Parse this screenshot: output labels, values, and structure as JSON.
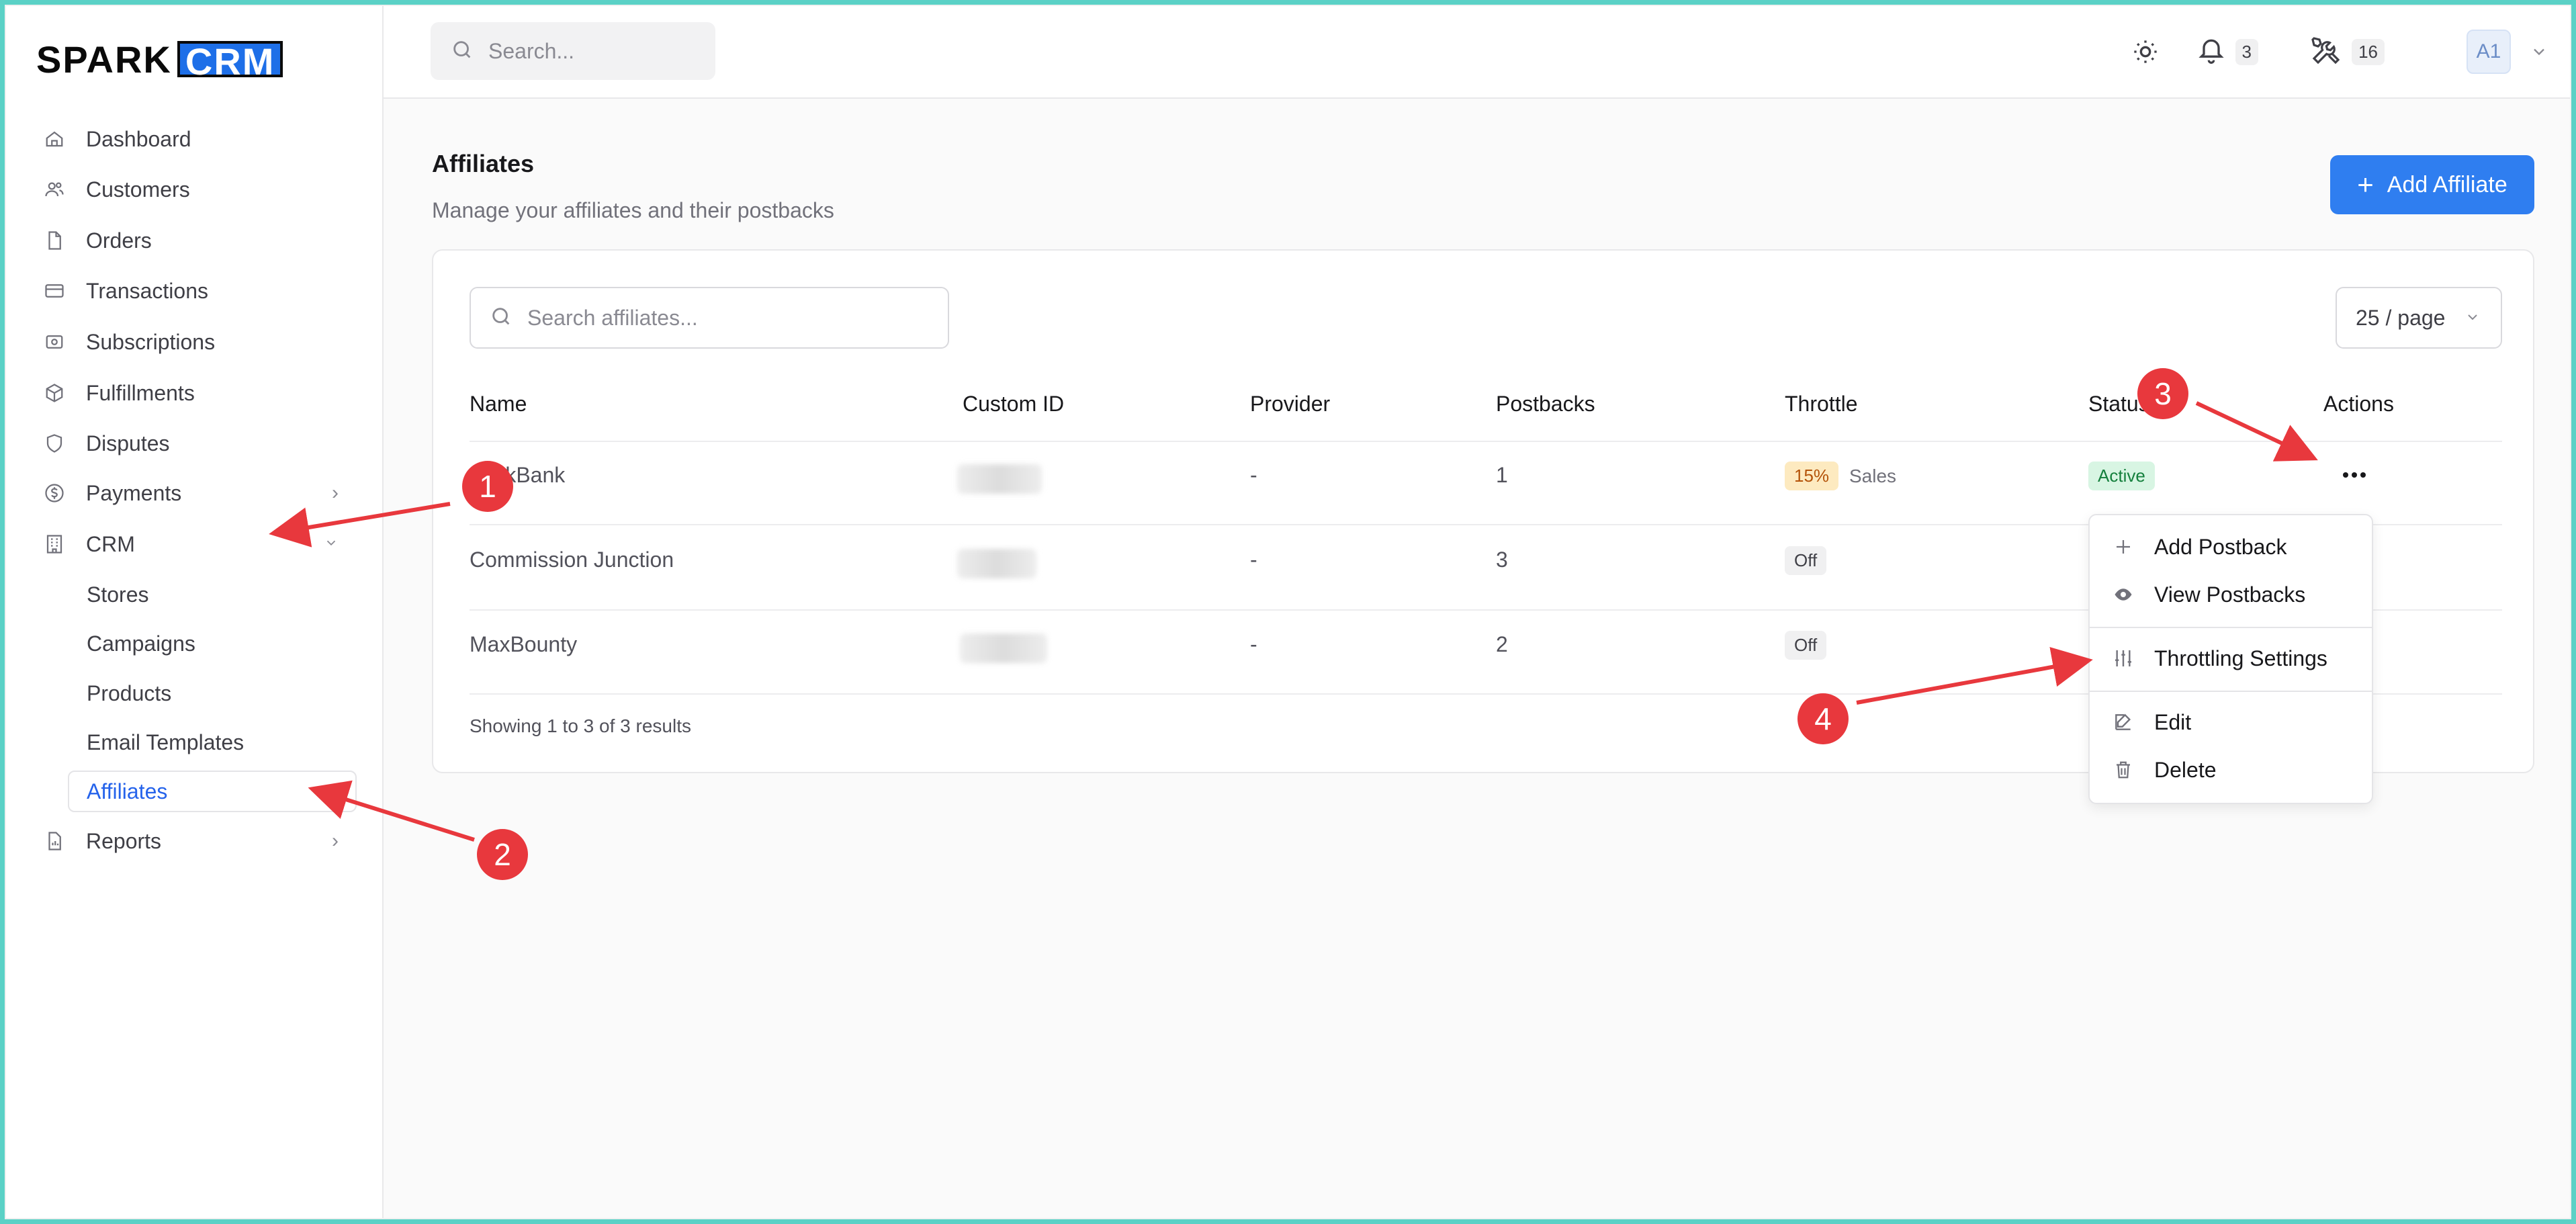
{
  "brand": {
    "left": "SPARK",
    "right": "CRM"
  },
  "sidebar": {
    "items": [
      {
        "label": "Dashboard",
        "icon": "home-icon"
      },
      {
        "label": "Customers",
        "icon": "users-icon"
      },
      {
        "label": "Orders",
        "icon": "file-icon"
      },
      {
        "label": "Transactions",
        "icon": "credit-card-icon"
      },
      {
        "label": "Subscriptions",
        "icon": "subscription-icon"
      },
      {
        "label": "Fulfillments",
        "icon": "package-icon"
      },
      {
        "label": "Disputes",
        "icon": "shield-icon"
      },
      {
        "label": "Payments",
        "icon": "dollar-icon"
      },
      {
        "label": "CRM",
        "icon": "building-icon"
      }
    ],
    "crm_sub": [
      "Stores",
      "Campaigns",
      "Products",
      "Email Templates",
      "Affiliates"
    ],
    "reports": "Reports"
  },
  "header": {
    "search_placeholder": "Search...",
    "notifications_count": "3",
    "tools_count": "16",
    "avatar": "A1"
  },
  "main": {
    "title": "Affiliates",
    "subtitle": "Manage your affiliates and their postbacks",
    "add_button": "Add Affiliate",
    "search_placeholder": "Search affiliates...",
    "per_page": "25 / page",
    "columns": [
      "Name",
      "Custom ID",
      "Provider",
      "Postbacks",
      "Throttle",
      "Status",
      "Actions"
    ],
    "rows": [
      {
        "name": "ClickBank",
        "provider": "-",
        "postbacks": "1",
        "throttle": "15%",
        "throttle_note": "Sales",
        "status": "Active"
      },
      {
        "name": "Commission Junction",
        "provider": "-",
        "postbacks": "3",
        "throttle": "Off"
      },
      {
        "name": "MaxBounty",
        "provider": "-",
        "postbacks": "2",
        "throttle": "Off"
      }
    ],
    "footer": "Showing 1 to 3 of 3 results"
  },
  "menu": {
    "items": [
      "Add Postback",
      "View Postbacks",
      "Throttling Settings",
      "Edit",
      "Delete"
    ]
  },
  "annotations": [
    "1",
    "2",
    "3",
    "4"
  ],
  "colors": {
    "accent": "#2f7ef0",
    "annotation": "#e8383d",
    "frame": "#5bd1c6"
  }
}
